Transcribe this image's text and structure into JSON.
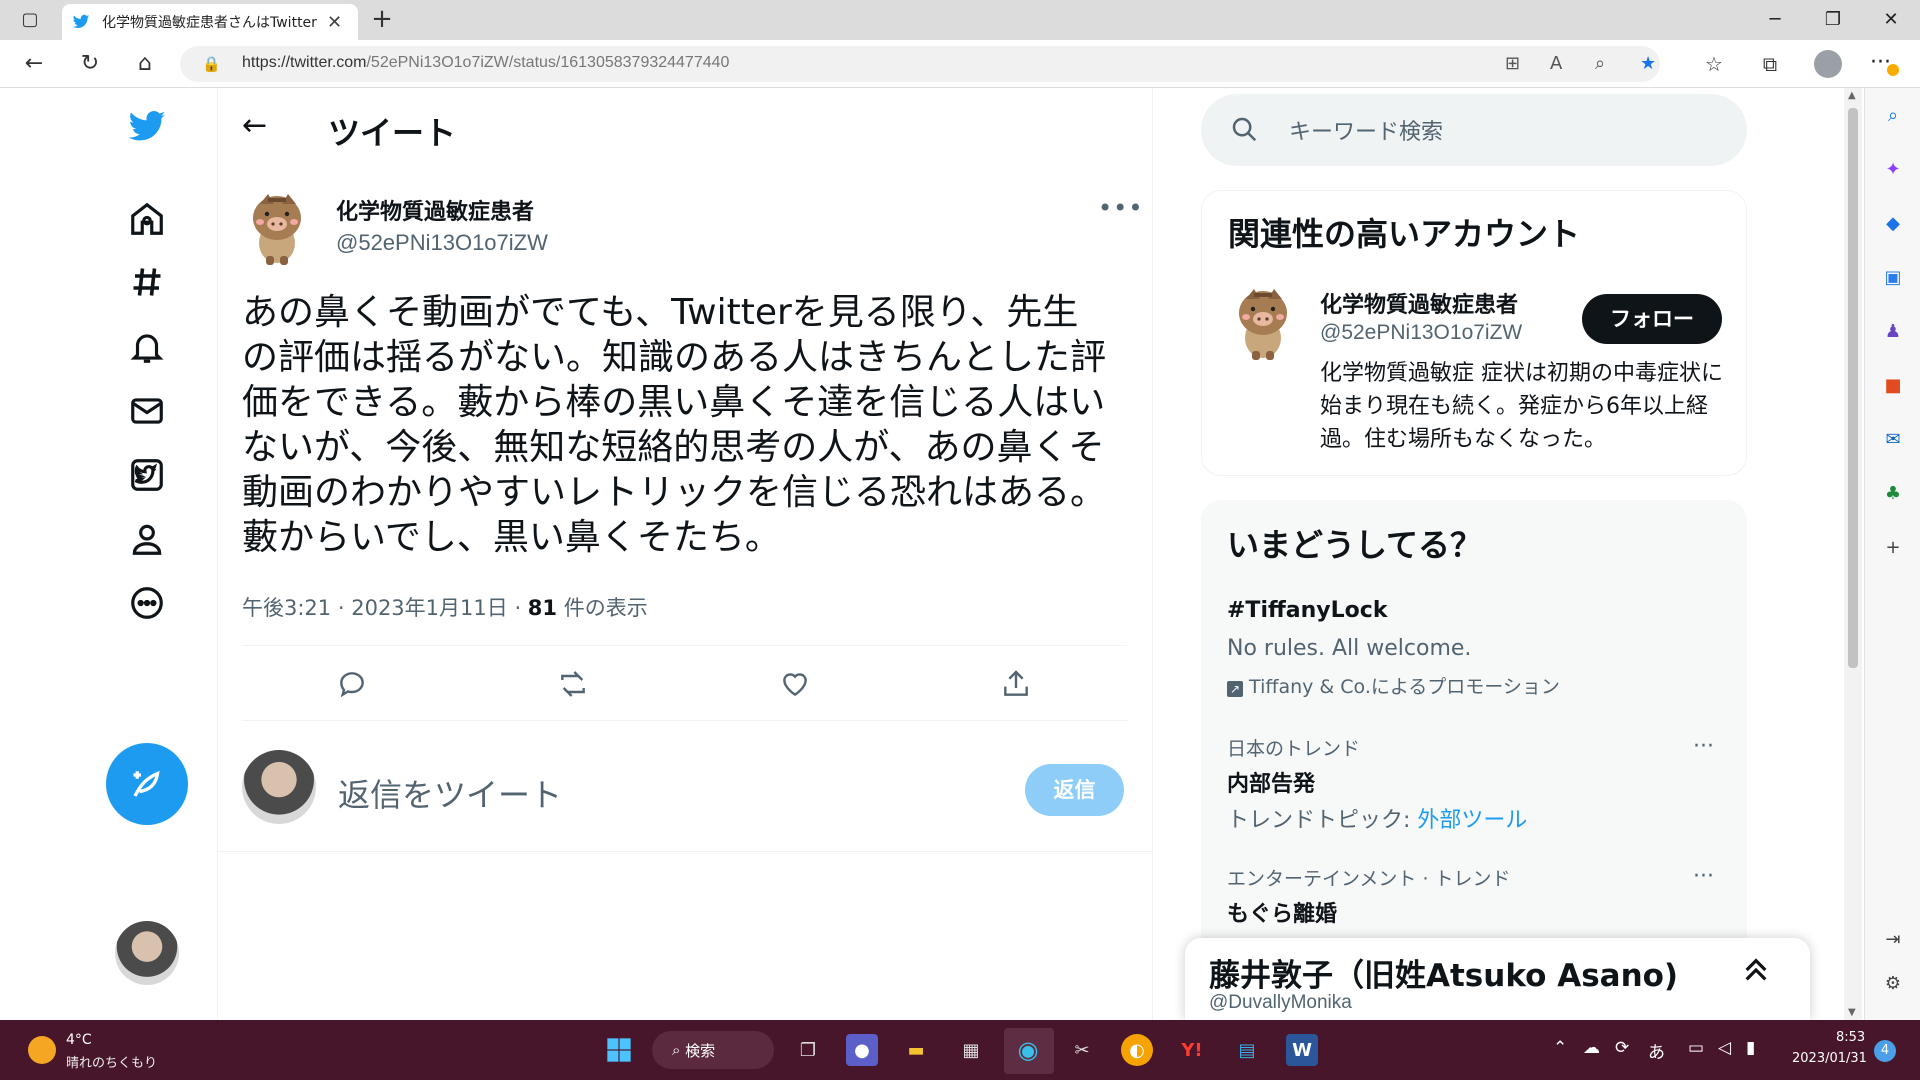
{
  "browser": {
    "tab_title": "化学物質過敏症患者さんはTwitter",
    "url_host": "https://twitter.com",
    "url_path": "/52ePNi13O1o7iZW/status/1613058379324477440"
  },
  "main": {
    "title": "ツイート",
    "tweet": {
      "author_name": "化学物質過敏症患者",
      "author_handle": "@52ePNi13O1o7iZW",
      "text": "あの鼻くそ動画がでても、Twitterを見る限り、先生の評価は揺るがない。知識のある人はきちんとした評価をできる。藪から棒の黒い鼻くそ達を信じる人はいないが、今後、無知な短絡的思考の人が、あの鼻くそ動画のわかりやすいレトリックを信じる恐れはある。藪からいでし、黒い鼻くそたち。",
      "time": "午後3:21",
      "date": "2023年1月11日",
      "views_count": "81",
      "views_label": "件の表示"
    },
    "reply": {
      "placeholder": "返信をツイート",
      "button": "返信"
    }
  },
  "sidebar": {
    "search_placeholder": "キーワード検索",
    "related": {
      "title": "関連性の高いアカウント",
      "name": "化学物質過敏症患者",
      "handle": "@52ePNi13O1o7iZW",
      "follow_label": "フォロー",
      "bio": "化学物質過敏症 症状は初期の中毒症状に始まり現在も続く。発症から6年以上経過。住む場所もなくなった。"
    },
    "trends": {
      "title": "いまどうしてる？",
      "items": [
        {
          "name": "#TiffanyLock",
          "desc": "No rules. All welcome.",
          "promo": "Tiffany & Co.によるプロモーション"
        },
        {
          "label": "日本のトレンド",
          "name": "内部告発",
          "desc_prefix": "トレンドトピック: ",
          "desc_link": "外部ツール"
        },
        {
          "label": "エンターテインメント · トレンド",
          "name": "もぐら離婚"
        }
      ]
    }
  },
  "messages_bar": {
    "name": "藤井敦子（旧姓Atsuko Asano)",
    "handle": "@DuvallyMonika"
  },
  "taskbar": {
    "temp": "4°C",
    "weather": "晴れのちくもり",
    "search_label": "検索",
    "ime": "あ",
    "time": "8:53",
    "date": "2023/01/31",
    "notifications": "4"
  },
  "colors": {
    "accent": "#1d9bf0",
    "text": "#0f1419",
    "secondary": "#536471",
    "taskbar": "#47162b"
  }
}
